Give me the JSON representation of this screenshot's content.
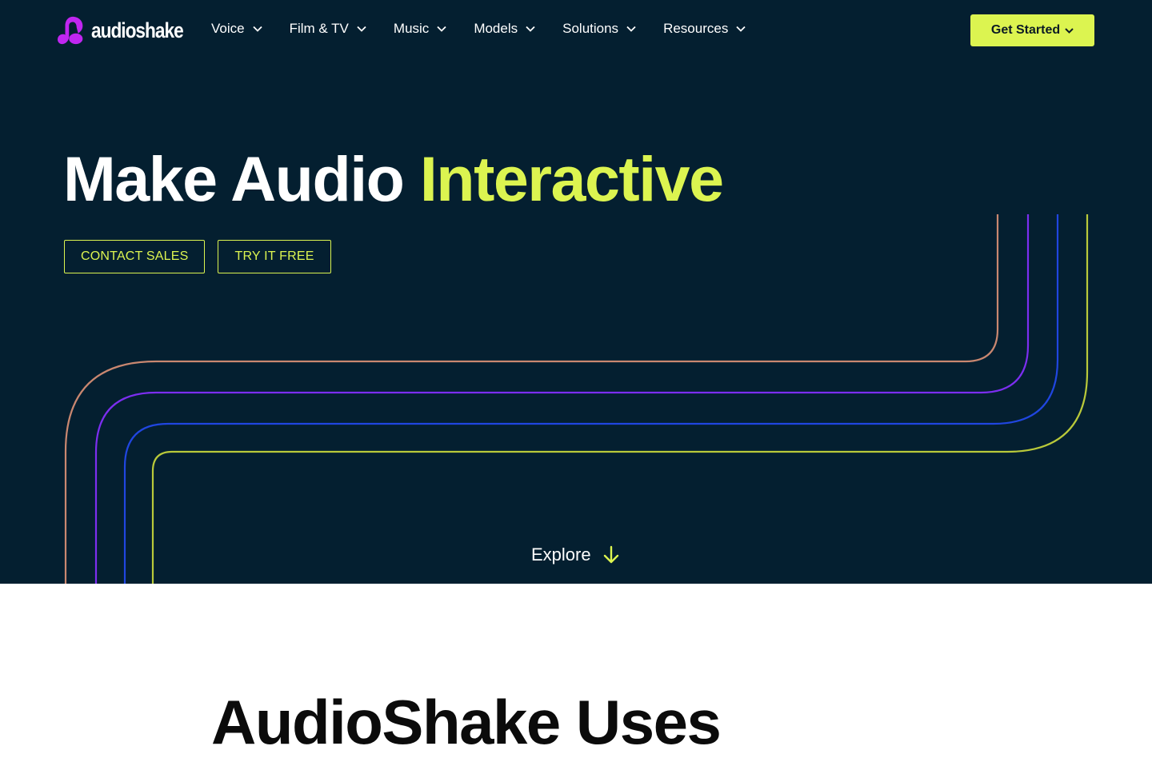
{
  "brand": {
    "name": "audioshake",
    "accent_color": "#dcf450",
    "logo_color": "#c026f0",
    "background_color": "#041f30"
  },
  "nav": {
    "items": [
      {
        "label": "Voice",
        "icon": "chevron-down-icon"
      },
      {
        "label": "Film & TV",
        "icon": "chevron-down-icon"
      },
      {
        "label": "Music",
        "icon": "chevron-down-icon"
      },
      {
        "label": "Models",
        "icon": "chevron-down-icon"
      },
      {
        "label": "Solutions",
        "icon": "chevron-down-icon"
      },
      {
        "label": "Resources",
        "icon": "chevron-down-icon"
      }
    ],
    "cta_label": "Get Started"
  },
  "hero": {
    "title_part1": "Make Audio",
    "title_part2": "Interactive",
    "contact_sales_label": "CONTACT SALES",
    "try_free_label": "TRY IT FREE",
    "line_colors": [
      "#c98770",
      "#7c2ef0",
      "#2046e0",
      "#b9c93a"
    ],
    "explore_label": "Explore",
    "explore_icon": "arrow-down-icon"
  },
  "uses": {
    "title": "AudioShake Uses"
  }
}
